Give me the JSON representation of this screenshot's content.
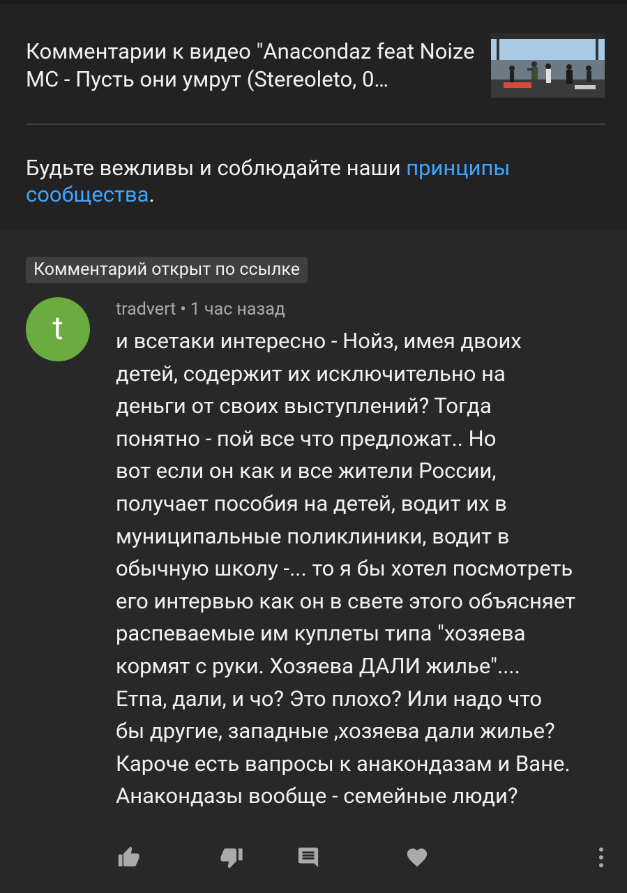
{
  "header": {
    "title": "Комментарии к видео \"Anacondaz feat Noize MC - Пусть они умрут (Stereoleto, 0…",
    "guidelines_prefix": "Будьте вежливы и соблюдайте наши ",
    "guidelines_link": "принципы сообщества",
    "guidelines_suffix": "."
  },
  "comment": {
    "badge": "Комментарий открыт по ссылке",
    "avatar_letter": "t",
    "author": "tradvert",
    "separator": "•",
    "time": "1 час назад",
    "text": "и всетаки интересно - Нойз, имея двоих\nдетей, содержит их исключительно  на\nденьги от своих выступлений? Тогда\nпонятно - пой все что предложат.. Но\nвот если он как и все жители России,\nполучает пособия на детей, водит их в\nмуниципальные поликлиники,  водит в\nобычную школу -... то я бы хотел  посмотреть\nего интервью как он в свете этого объясняет\nраспеваемые им куплеты типа \"хозяева\nкормят с руки. Хозяева ДАЛИ жилье\"....\nЕтпа, дали, и чо?  Это плохо? Или надо что\nбы другие, западные ,хозяева дали жилье?\nКароче есть вапросы к анакондазам и Ване.\nАнакондазы вообще - семейные люди?"
  },
  "actions": {
    "like_icon": "thumb-up-icon",
    "dislike_icon": "thumb-down-icon",
    "reply_icon": "comment-reply-icon",
    "heart_icon": "heart-icon",
    "more_icon": "more-vertical-icon"
  },
  "colors": {
    "background": "#282828",
    "header_background": "#222222",
    "link": "#3ea6ff",
    "avatar": "#6aac3e",
    "secondary_text": "#aaaaaa"
  }
}
